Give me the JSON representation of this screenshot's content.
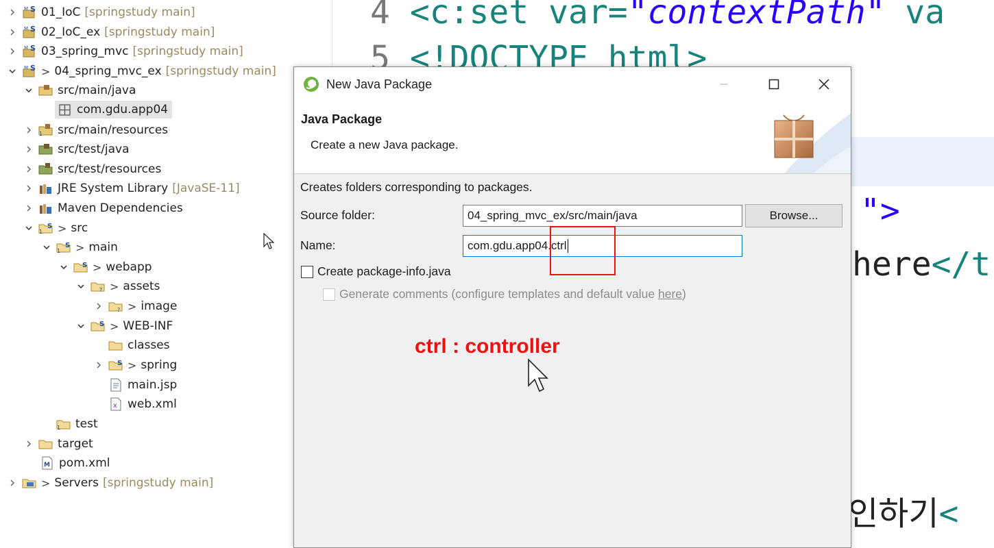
{
  "explorer": {
    "items": [
      {
        "label": "01_IoC",
        "deco": "[springstudy main]"
      },
      {
        "label": "02_IoC_ex",
        "deco": "[springstudy main]"
      },
      {
        "label": "03_spring_mvc",
        "deco": "[springstudy main]"
      },
      {
        "label": "04_spring_mvc_ex",
        "deco": "[springstudy main]"
      },
      {
        "label": "src/main/java"
      },
      {
        "label": "com.gdu.app04"
      },
      {
        "label": "src/main/resources"
      },
      {
        "label": "src/test/java"
      },
      {
        "label": "src/test/resources"
      },
      {
        "label": "JRE System Library",
        "deco": "[JavaSE-11]"
      },
      {
        "label": "Maven Dependencies"
      },
      {
        "label": "src"
      },
      {
        "label": "main"
      },
      {
        "label": "webapp"
      },
      {
        "label": "assets"
      },
      {
        "label": "image"
      },
      {
        "label": "WEB-INF"
      },
      {
        "label": "classes"
      },
      {
        "label": "spring"
      },
      {
        "label": "main.jsp"
      },
      {
        "label": "web.xml"
      },
      {
        "label": "test"
      },
      {
        "label": "target"
      },
      {
        "label": "pom.xml"
      },
      {
        "label": "Servers",
        "deco": "[springstudy main]"
      }
    ]
  },
  "editor": {
    "line4_num": "4",
    "line4_tag": "<c:set",
    "line4_attr": "var=",
    "line4_str": "\"contextPath\"",
    "line4_attr2": "va",
    "line5_num": "5",
    "line5_text": "<!DOCTYPE html>",
    "frag_quote": "\">",
    "frag_here": "here",
    "frag_close": "</t",
    "frag_korean": "인하기",
    "frag_lt": "<"
  },
  "dialog": {
    "title": "New Java Package",
    "banner_title": "Java Package",
    "banner_desc": "Create a new Java package.",
    "info": "Creates folders corresponding to packages.",
    "source_label": "Source folder:",
    "source_value": "04_spring_mvc_ex/src/main/java",
    "browse_label": "Browse...",
    "name_label": "Name:",
    "name_value": "com.gdu.app04.ctrl",
    "pkg_info_label": "Create package-info.java",
    "gen_comments_label": "Generate comments (configure templates and default value ",
    "gen_comments_link": "here",
    "gen_comments_end": ")"
  },
  "annotation": {
    "text": "ctrl : controller"
  },
  "colors": {
    "annotation": "#ee1111",
    "focus": "#0078d7",
    "deco": "#9b8a61"
  }
}
